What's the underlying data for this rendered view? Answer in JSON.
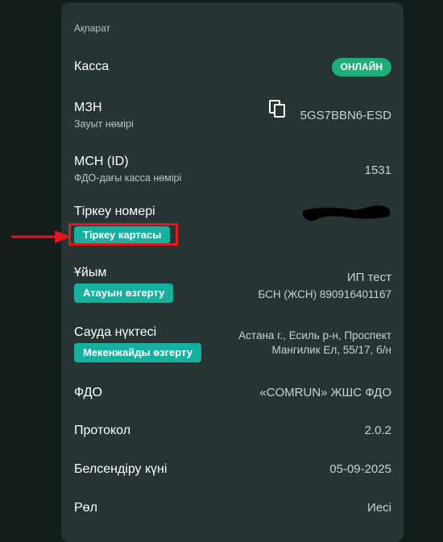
{
  "section_title": "Ақпарат",
  "kassa": {
    "label": "Касса",
    "status": "ОНЛАЙН",
    "status_color": "#1fae76"
  },
  "mzn": {
    "label": "МЗН",
    "sublabel": "Зауыт нөмірі",
    "value": "5GS7BBN6-ESD",
    "copy_icon": "copy-icon"
  },
  "mch": {
    "label": "МСН (ID)",
    "sublabel": "ФДО-дағы касса нөмірі",
    "value": "1531"
  },
  "reg": {
    "label": "Тіркеу номері",
    "button": "Тіркеу картасы",
    "value_redacted": true
  },
  "org": {
    "label": "Ұйым",
    "button": "Атауын өзгерту",
    "name": "ИП тест",
    "bin": "БСН (ЖСН) 890916401167"
  },
  "point": {
    "label": "Сауда нүктесі",
    "button": "Мекенжайды өзгерту",
    "address_line1": "Астана г., Есиль р-н, Проспект",
    "address_line2": "Мангилик Ел, 55/17, б/н"
  },
  "fdo": {
    "label": "ФДО",
    "value": "«COMRUN» ЖШС ФДО"
  },
  "protocol": {
    "label": "Протокол",
    "value": "2.0.2"
  },
  "activation": {
    "label": "Белсендіру күні",
    "value": "05-09-2025"
  },
  "role": {
    "label": "Рөл",
    "value": "Иесі"
  },
  "accent_colors": {
    "button": "#17b09e",
    "annotation": "#e0191f"
  }
}
